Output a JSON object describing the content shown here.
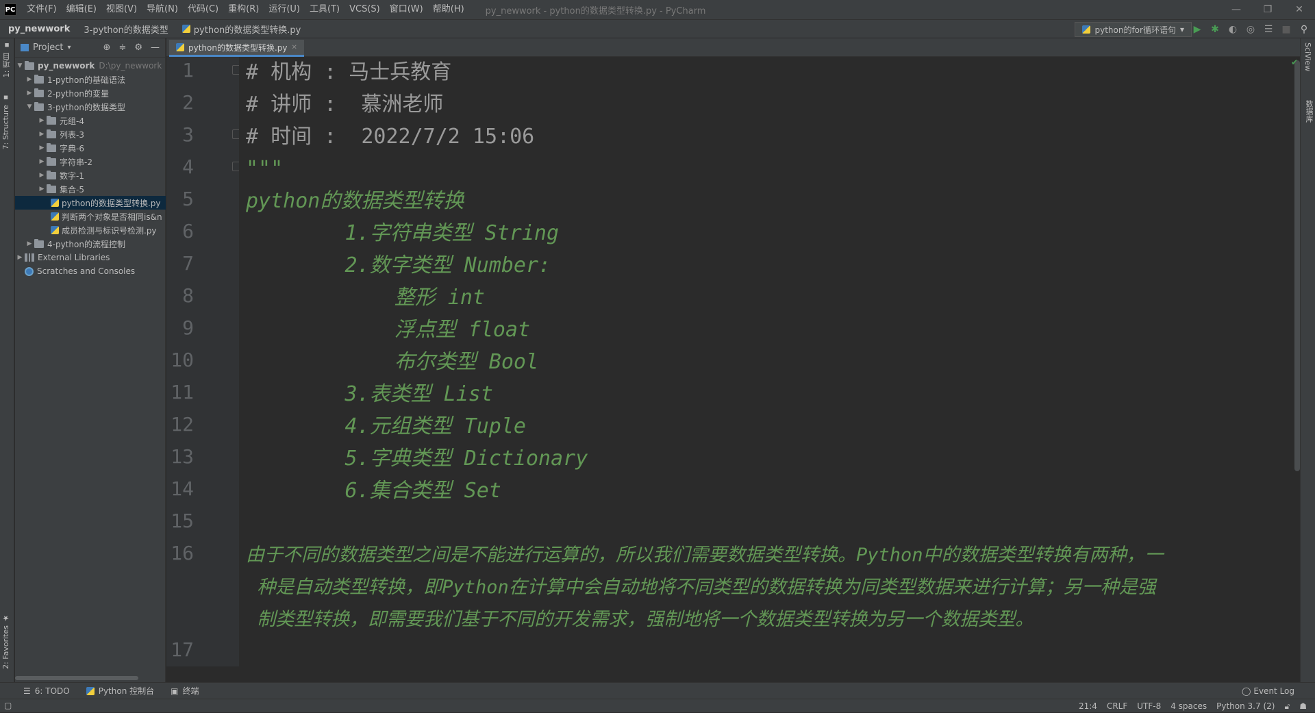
{
  "titlebar": {
    "logo": "PC",
    "menus": [
      "文件(F)",
      "编辑(E)",
      "视图(V)",
      "导航(N)",
      "代码(C)",
      "重构(R)",
      "运行(U)",
      "工具(T)",
      "VCS(S)",
      "窗口(W)",
      "帮助(H)"
    ],
    "window_title": "py_newwork - python的数据类型转换.py - PyCharm"
  },
  "navbar": {
    "project": "py_newwork",
    "folder": "3-python的数据类型",
    "file": "python的数据类型转换.py",
    "run_config": "python的for循环语句"
  },
  "left_strip": {
    "project_tab": "1: 项目",
    "structure_tab": "7: Structure",
    "favorites_tab": "2: Favorites"
  },
  "right_strip": {
    "sciview_tab": "SciView",
    "database_tab": "数据库"
  },
  "project_panel": {
    "header": "Project",
    "root": {
      "name": "py_newwork",
      "path": "D:\\py_newwork"
    },
    "items": [
      "1-python的基础语法",
      "2-python的变量",
      "3-python的数据类型",
      "元组-4",
      "列表-3",
      "字典-6",
      "字符串-2",
      "数字-1",
      "集合-5",
      "python的数据类型转换.py",
      "判断两个对象是否相同is&n",
      "成员检测与标识号检测.py",
      "4-python的流程控制",
      "External Libraries",
      "Scratches and Consoles"
    ]
  },
  "editor": {
    "tab": "python的数据类型转换.py",
    "line_numbers": [
      "1",
      "2",
      "3",
      "4",
      "5",
      "6",
      "7",
      "8",
      "9",
      "10",
      "11",
      "12",
      "13",
      "14",
      "15",
      "16",
      "17"
    ],
    "lines": [
      "# 机构 : 马士兵教育",
      "# 讲师 :  慕洲老师",
      "# 时间 :  2022/7/2 15:06",
      "\"\"\"",
      "python的数据类型转换",
      "        1.字符串类型 String",
      "        2.数字类型 Number:",
      "            整形 int",
      "            浮点型 float",
      "            布尔类型 Bool",
      "        3.表类型 List",
      "        4.元组类型 Tuple",
      "        5.字典类型 Dictionary",
      "        6.集合类型 Set",
      "",
      "由于不同的数据类型之间是不能进行运算的，所以我们需要数据类型转换。Python中的数据类型转换有两种，一",
      " 种是自动类型转换，即Python在计算中会自动地将不同类型的数据转换为同类型数据来进行计算；另一种是强",
      " 制类型转换，即需要我们基于不同的开发需求，强制地将一个数据类型转换为另一个数据类型。"
    ]
  },
  "bottombar": {
    "todo": "6: TODO",
    "python_console": "Python 控制台",
    "terminal": "终端",
    "event_log": "Event Log"
  },
  "statusbar": {
    "position": "21:4",
    "line_sep": "CRLF",
    "encoding": "UTF-8",
    "indent": "4 spaces",
    "interpreter": "Python 3.7 (2)"
  },
  "colors": {
    "accent": "#4a88c7",
    "docstring": "#629755",
    "comment": "#9a9a9a",
    "selection": "#0d293e"
  }
}
